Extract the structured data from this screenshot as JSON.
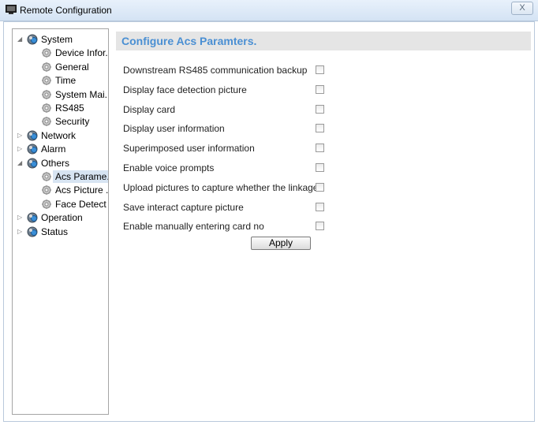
{
  "window": {
    "title": "Remote Configuration",
    "close_label": "X",
    "app_icon": "monitor-icon"
  },
  "tree": {
    "items": [
      {
        "label": "System",
        "level": 0,
        "expanded": true,
        "icon": "globe-icon"
      },
      {
        "label": "Device Infor...",
        "level": 1,
        "icon": "gear-icon"
      },
      {
        "label": "General",
        "level": 1,
        "icon": "gear-icon"
      },
      {
        "label": "Time",
        "level": 1,
        "icon": "gear-icon"
      },
      {
        "label": "System Mai...",
        "level": 1,
        "icon": "gear-icon"
      },
      {
        "label": "RS485",
        "level": 1,
        "icon": "gear-icon"
      },
      {
        "label": "Security",
        "level": 1,
        "icon": "gear-icon"
      },
      {
        "label": "Network",
        "level": 0,
        "expanded": false,
        "icon": "globe-icon"
      },
      {
        "label": "Alarm",
        "level": 0,
        "expanded": false,
        "icon": "globe-icon"
      },
      {
        "label": "Others",
        "level": 0,
        "expanded": true,
        "icon": "globe-icon"
      },
      {
        "label": "Acs Parame...",
        "level": 1,
        "selected": true,
        "icon": "gear-icon"
      },
      {
        "label": "Acs Picture ...",
        "level": 1,
        "icon": "gear-icon"
      },
      {
        "label": "Face Detect",
        "level": 1,
        "icon": "gear-icon"
      },
      {
        "label": "Operation",
        "level": 0,
        "expanded": false,
        "icon": "globe-icon"
      },
      {
        "label": "Status",
        "level": 0,
        "expanded": false,
        "icon": "globe-icon"
      }
    ]
  },
  "content": {
    "heading": "Configure Acs Paramters.",
    "options": [
      {
        "label": "Downstream RS485 communication backup",
        "checked": false
      },
      {
        "label": "Display face detection picture",
        "checked": false
      },
      {
        "label": "Display card",
        "checked": false
      },
      {
        "label": "Display user information",
        "checked": false
      },
      {
        "label": "Superimposed user information",
        "checked": false
      },
      {
        "label": "Enable voice prompts",
        "checked": false
      },
      {
        "label": "Upload pictures to capture whether the linkage",
        "checked": false
      },
      {
        "label": "Save interact capture picture",
        "checked": false
      },
      {
        "label": "Enable manually entering card no",
        "checked": false
      }
    ],
    "apply_label": "Apply"
  },
  "colors": {
    "heading": "#4a8fd3",
    "selection": "#d7e4f2",
    "titlebar": "#d4e3f4"
  }
}
